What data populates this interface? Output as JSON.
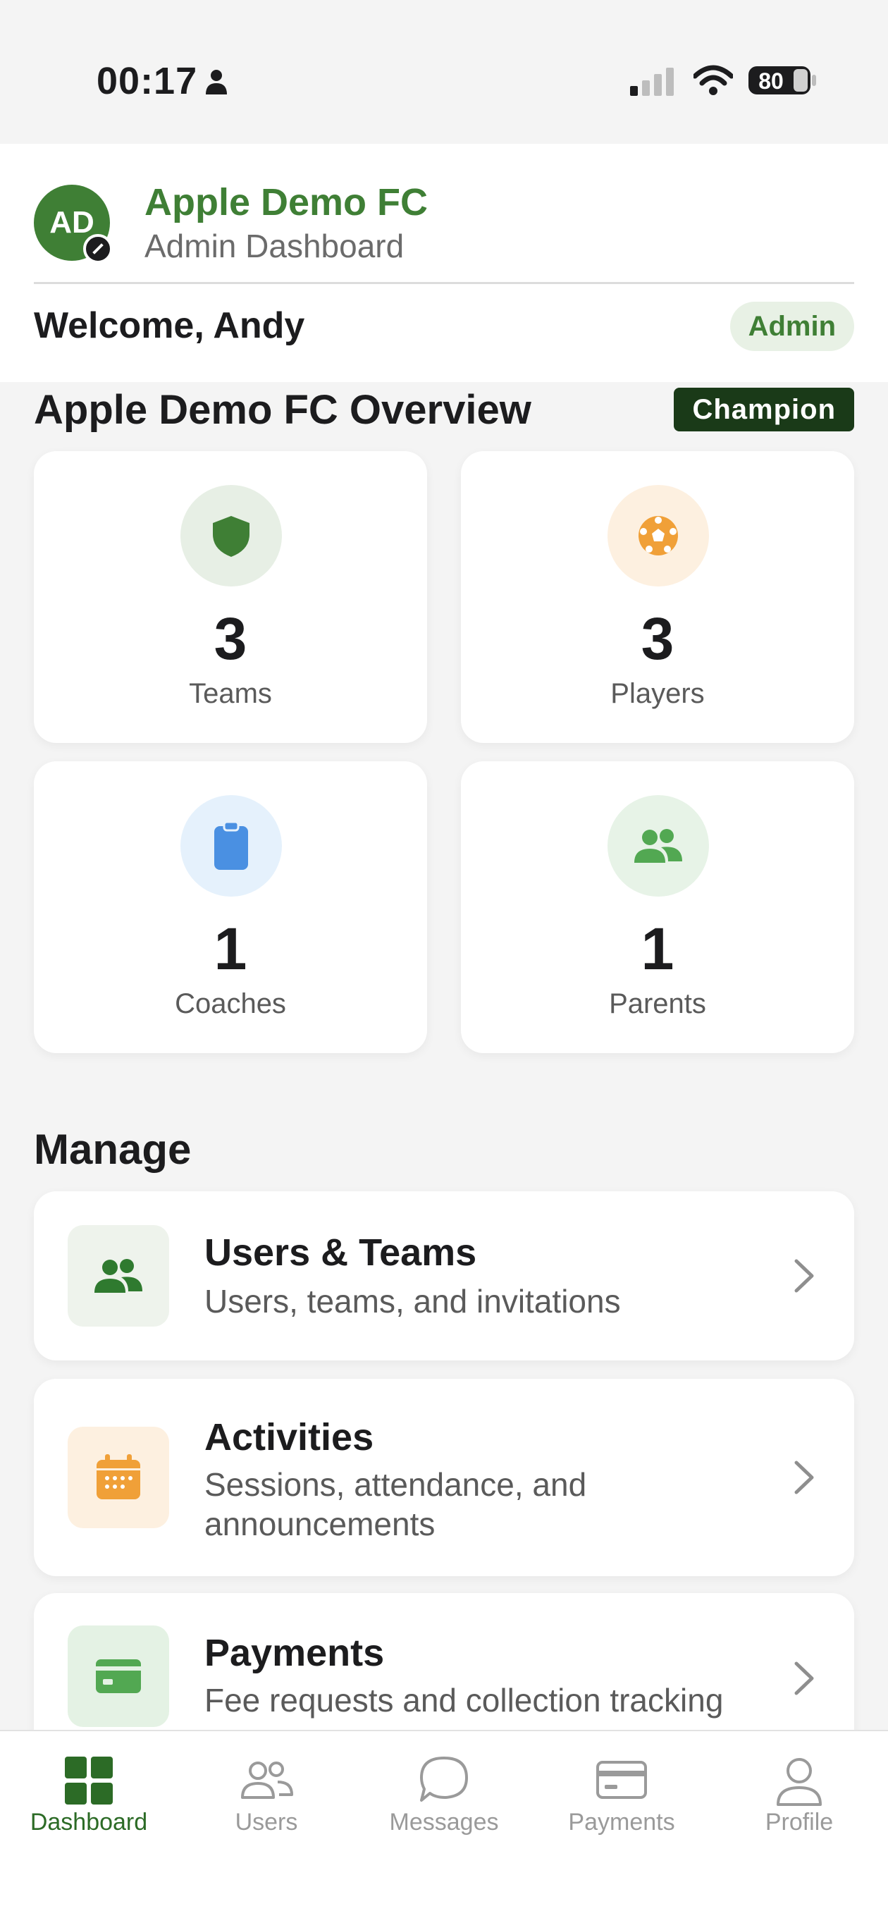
{
  "status_bar": {
    "time": "00:17",
    "battery": "80"
  },
  "header": {
    "avatar_initials": "AD",
    "club_name": "Apple Demo FC",
    "subtitle": "Admin Dashboard",
    "welcome": "Welcome, Andy",
    "role": "Admin"
  },
  "overview": {
    "title": "Apple Demo FC Overview",
    "tier": "Champion",
    "stats": [
      {
        "value": "3",
        "label": "Teams",
        "icon": "shield-icon",
        "color": "#3f7f35",
        "bg": "#e7efe5"
      },
      {
        "value": "3",
        "label": "Players",
        "icon": "soccer-ball-icon",
        "color": "#f0a038",
        "bg": "#fdf0e0"
      },
      {
        "value": "1",
        "label": "Coaches",
        "icon": "clipboard-icon",
        "color": "#4a90e2",
        "bg": "#e5f1fc"
      },
      {
        "value": "1",
        "label": "Parents",
        "icon": "people-icon",
        "color": "#52a852",
        "bg": "#e7f3e7"
      }
    ]
  },
  "manage": {
    "title": "Manage",
    "items": [
      {
        "title": "Users & Teams",
        "subtitle": "Users, teams, and invitations",
        "icon": "people-icon",
        "color": "#2f7a2f",
        "bg": "#eef3ec"
      },
      {
        "title": "Activities",
        "subtitle": "Sessions, attendance, and announcements",
        "icon": "calendar-icon",
        "color": "#f0a038",
        "bg": "#fdf0e0"
      },
      {
        "title": "Payments",
        "subtitle": "Fee requests and collection tracking",
        "icon": "card-icon",
        "color": "#52a852",
        "bg": "#e4f2e4"
      }
    ]
  },
  "tabs": [
    {
      "label": "Dashboard",
      "icon": "grid-icon",
      "active": true
    },
    {
      "label": "Users",
      "icon": "users-icon",
      "active": false
    },
    {
      "label": "Messages",
      "icon": "chat-bubble-icon",
      "active": false
    },
    {
      "label": "Payments",
      "icon": "card-icon",
      "active": false
    },
    {
      "label": "Profile",
      "icon": "person-icon",
      "active": false
    }
  ],
  "colors": {
    "brand": "#3f7f35",
    "tier_bg": "#1a3a18",
    "active_tab": "#2c6b26",
    "inactive_tab": "#9a9a9a"
  }
}
